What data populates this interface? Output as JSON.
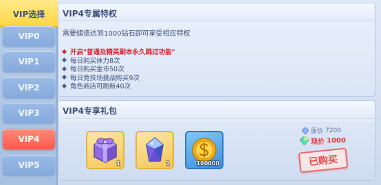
{
  "sidebar": {
    "header": "VIP选择",
    "tabs": [
      "VIP0",
      "VIP1",
      "VIP2",
      "VIP3",
      "VIP4",
      "VIP5"
    ],
    "active_tab": "VIP4"
  },
  "privileges": {
    "title": "VIP4专属特权",
    "description": "需要储值达到1000钻石即可享受相应特权",
    "benefits": [
      "开启\"普通及精英副本永久跳过功能\"",
      "每日购买体力8次",
      "每日购买金币50次",
      "每日竞技场挑战购买9次",
      "角色商店可刷新40次"
    ]
  },
  "gift": {
    "title": "VIP4专享礼包",
    "items": [
      {
        "icon": "purple-gift-box-icon",
        "count": "1"
      },
      {
        "icon": "blue-gem-icon",
        "count": "1"
      },
      {
        "icon": "gold-coin-icon",
        "count": "160000"
      }
    ],
    "original_price_label": "原价",
    "original_price": "7200",
    "current_price_label": "现价",
    "current_price": "1000",
    "status": "已购买"
  },
  "colors": {
    "active_tab": "#ff5a4a",
    "header_tab": "#ffd53d",
    "highlight_text": "#e0232f"
  }
}
